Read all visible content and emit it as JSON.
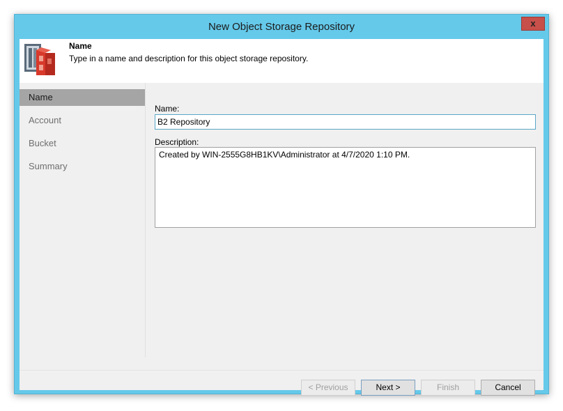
{
  "window": {
    "title": "New Object Storage Repository",
    "close_glyph": "x"
  },
  "header": {
    "title": "Name",
    "description": "Type in a name and description for this object storage repository.",
    "icon": "object-storage-icon"
  },
  "steps": [
    {
      "label": "Name",
      "active": true
    },
    {
      "label": "Account",
      "active": false
    },
    {
      "label": "Bucket",
      "active": false
    },
    {
      "label": "Summary",
      "active": false
    }
  ],
  "form": {
    "name_label": "Name:",
    "name_value": "B2 Repository",
    "description_label": "Description:",
    "description_value": "Created by WIN-2555G8HB1KV\\Administrator at 4/7/2020 1:10 PM."
  },
  "buttons": {
    "previous": "< Previous",
    "next": "Next >",
    "finish": "Finish",
    "cancel": "Cancel"
  },
  "colors": {
    "titlebar": "#65c9ea",
    "close": "#c7504a",
    "active_step": "#a5a5a5",
    "icon_red": "#d8392b"
  }
}
